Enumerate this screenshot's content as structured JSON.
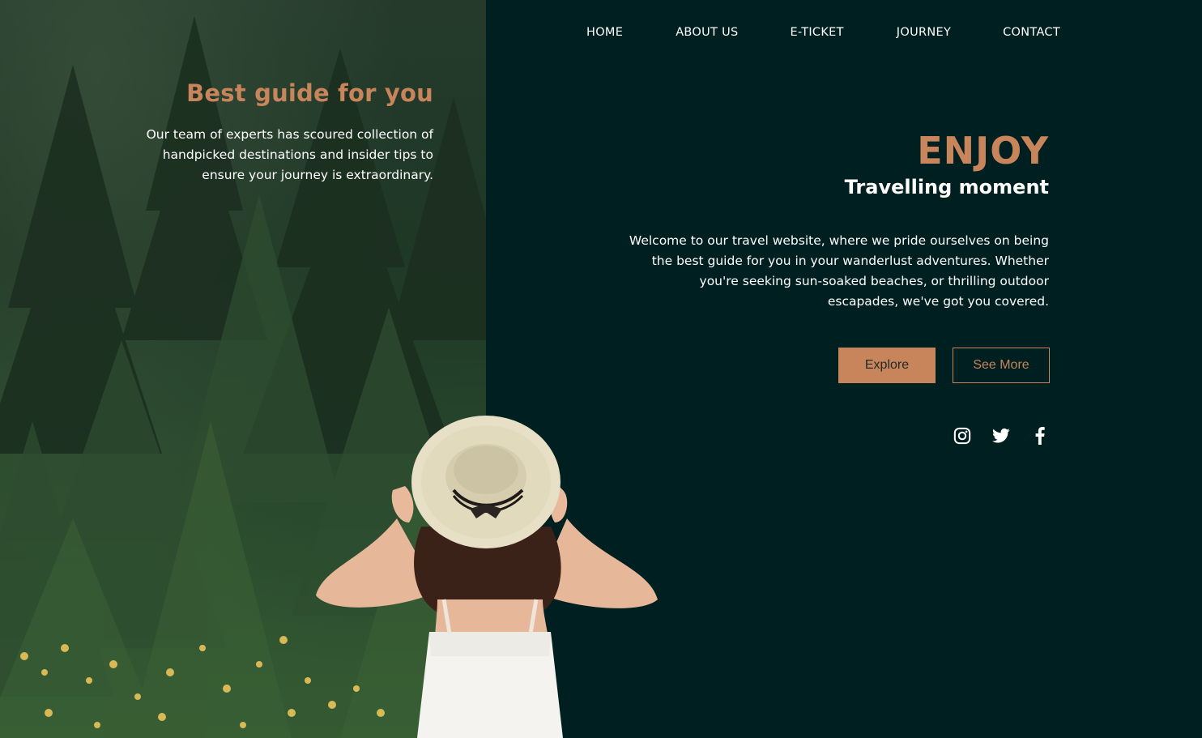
{
  "nav": {
    "items": [
      {
        "label": "HOME"
      },
      {
        "label": "ABOUT US"
      },
      {
        "label": "E-TICKET"
      },
      {
        "label": "JOURNEY"
      },
      {
        "label": "CONTACT"
      }
    ]
  },
  "left": {
    "title": "Best guide for you",
    "body_lines": [
      "Our team of experts has scoured collection of",
      "handpicked destinations and insider tips to",
      "ensure your journey is extraordinary."
    ]
  },
  "hero": {
    "title": "ENJOY",
    "subtitle": "Travelling moment",
    "body_lines": [
      "Welcome to our travel website, where we pride ourselves on being",
      "the best guide for you in your wanderlust adventures. Whether",
      "you're seeking sun-soaked beaches, or thrilling outdoor",
      "escapades, we've got you covered."
    ],
    "explore_label": "Explore",
    "see_more_label": "See More"
  },
  "social": {
    "icons": [
      "instagram-icon",
      "twitter-icon",
      "facebook-icon"
    ]
  },
  "colors": {
    "accent": "#c8845a",
    "background": "#001f20",
    "text": "#ffffff"
  }
}
